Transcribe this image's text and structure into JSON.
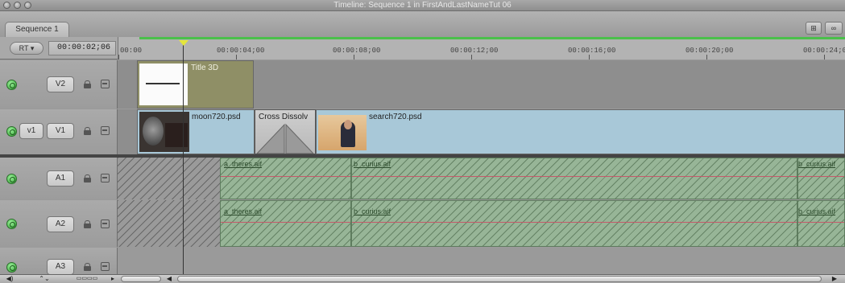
{
  "window": {
    "title": "Timeline: Sequence 1 in FirstAndLastNameTut 06"
  },
  "tabs": [
    {
      "label": "Sequence 1"
    }
  ],
  "toolbar": {
    "rt_label": "RT",
    "timecode": "00:00:02;06"
  },
  "ruler": {
    "labels": [
      "00:00",
      "00:00:04;00",
      "00:00:08;00",
      "00:00:12;00",
      "00:00:16;00",
      "00:00:20;00",
      "00:00:24;0"
    ]
  },
  "tracks": {
    "v2": {
      "label": "V2"
    },
    "v1": {
      "source_label": "v1",
      "label": "V1"
    },
    "a1": {
      "label": "A1"
    },
    "a2": {
      "label": "A2"
    },
    "a3": {
      "label": "A3"
    }
  },
  "clips": {
    "title3d": "Title 3D",
    "moon": "moon720.psd",
    "dissolve": "Cross Dissolv",
    "search": "search720.psd",
    "a1_theres": "a_theres.aif",
    "a1_curius": "b_curius.aif",
    "a1_curius_end": "b_curius.aif",
    "a2_theres": "a_theres.aif",
    "a2_curius": "b_curius.aif",
    "a2_curius_end": "b_curius.aif"
  },
  "colors": {
    "playhead_marker": "#e4e63a",
    "render_bar": "#4ac04a",
    "video_track": "#a8c8d8",
    "audio_track": "#97b597",
    "title_clip": "#8f8f66"
  },
  "icons": [
    "window-close-icon",
    "window-minimize-icon",
    "window-zoom-icon",
    "track-visibility-icon",
    "lock-icon",
    "link-icon",
    "speaker-icon",
    "snapping-icon",
    "zoom-slider-icon"
  ]
}
